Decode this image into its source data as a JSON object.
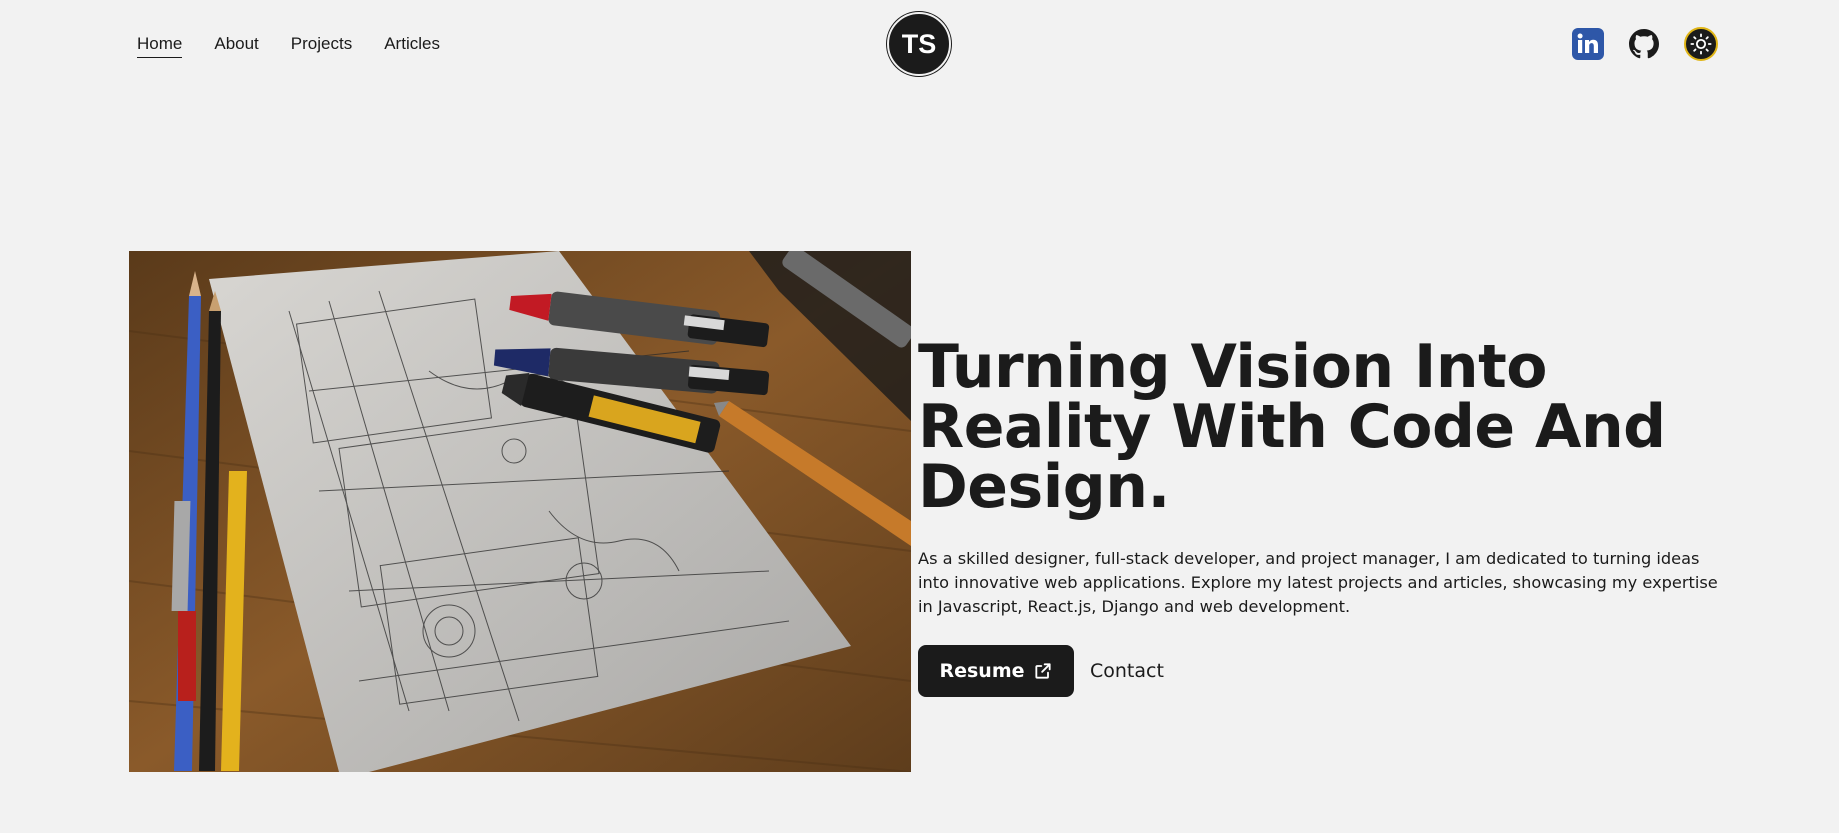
{
  "nav": {
    "items": [
      {
        "label": "Home",
        "active": true
      },
      {
        "label": "About",
        "active": false
      },
      {
        "label": "Projects",
        "active": false
      },
      {
        "label": "Articles",
        "active": false
      }
    ]
  },
  "logo": {
    "initials": "TS"
  },
  "socials": {
    "icons": [
      "linkedin-icon",
      "github-icon",
      "sun-icon"
    ]
  },
  "hero": {
    "image_icon": "drafting-sketch-with-pencils-image",
    "headline_lines": [
      "Turning Vision Into",
      "Reality With Code And",
      "Design."
    ],
    "intro": "As a skilled designer, full-stack developer, and project manager, I am dedicated to turning ideas into innovative web applications. Explore my latest projects and articles, showcasing my expertise in Javascript, React.js, Django and web development.",
    "resume_label": "Resume",
    "contact_label": "Contact"
  },
  "colors": {
    "background": "#f2f2f2",
    "text": "#1b1b1b",
    "linkedin": "#2e57a8",
    "theme_ring": "#e0b516"
  }
}
